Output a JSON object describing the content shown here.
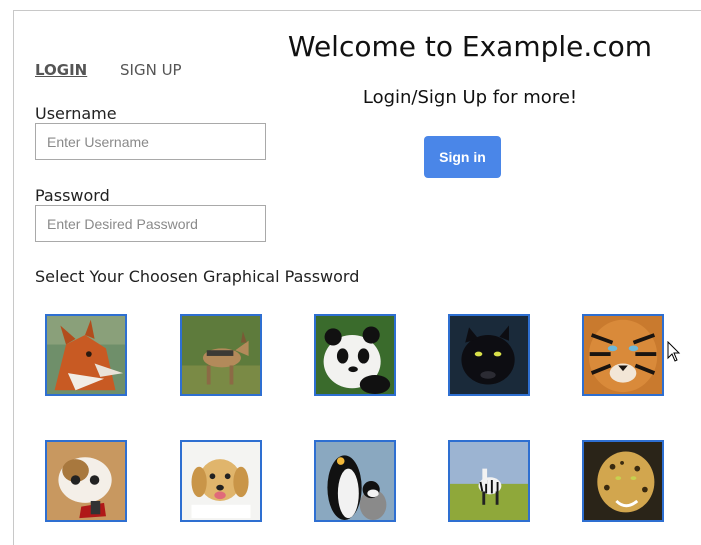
{
  "header": {
    "welcome": "Welcome to Example.com",
    "subtitle": "Login/Sign Up for more!",
    "signin_label": "Sign in"
  },
  "tabs": [
    {
      "label": "LOGIN",
      "active": true
    },
    {
      "label": "SIGN UP",
      "active": false
    }
  ],
  "form": {
    "username_label": "Username",
    "username_placeholder": "Enter Username",
    "username_value": "",
    "password_label": "Password",
    "password_placeholder": "Enter Desired Password",
    "password_value": "",
    "graphical_label": "Select Your Choosen Graphical Password"
  },
  "gallery": [
    {
      "icon": "fox-image"
    },
    {
      "icon": "jackal-image"
    },
    {
      "icon": "panda-image"
    },
    {
      "icon": "black-panther-image"
    },
    {
      "icon": "tiger-image"
    },
    {
      "icon": "cat-image"
    },
    {
      "icon": "puppy-image"
    },
    {
      "icon": "penguins-image"
    },
    {
      "icon": "zebra-image"
    },
    {
      "icon": "leopard-image"
    }
  ],
  "colors": {
    "accent": "#4a86e8",
    "tile_border": "#2e6fd1"
  }
}
